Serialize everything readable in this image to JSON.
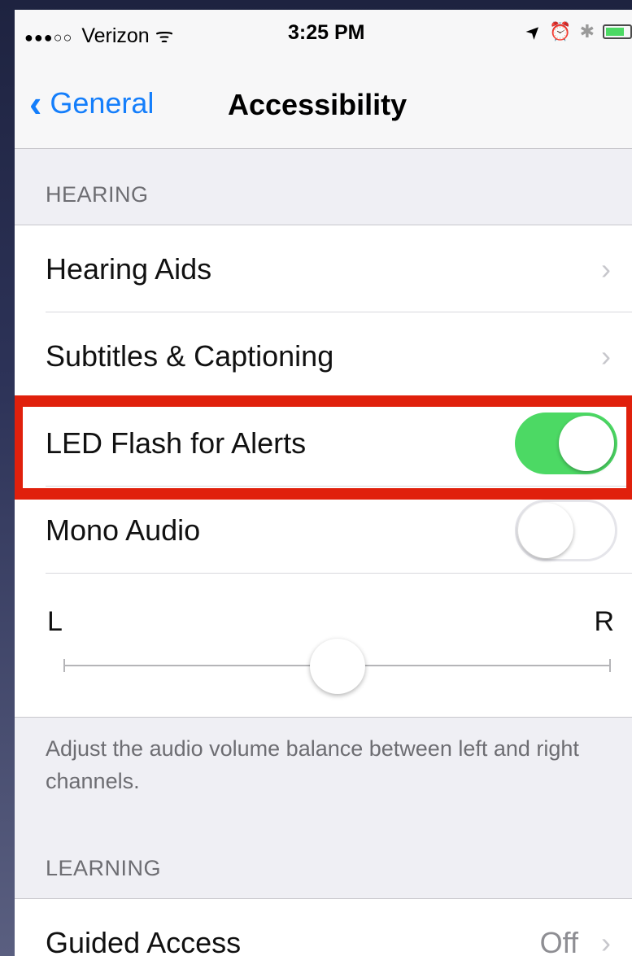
{
  "status_bar": {
    "signal_dots": "●●●○○",
    "carrier": "Verizon",
    "wifi_glyph": "ᯤ",
    "time": "3:25 PM",
    "location_glyph": "➤",
    "alarm_glyph": "⏰",
    "bluetooth_glyph": "✱"
  },
  "nav": {
    "back_label": "General",
    "title": "Accessibility"
  },
  "sections": {
    "hearing_header": "HEARING",
    "learning_header": "LEARNING"
  },
  "rows": {
    "hearing_aids": {
      "label": "Hearing Aids"
    },
    "subtitles": {
      "label": "Subtitles & Captioning"
    },
    "led_flash": {
      "label": "LED Flash for Alerts",
      "on": true
    },
    "mono_audio": {
      "label": "Mono Audio",
      "on": false
    },
    "guided_access": {
      "label": "Guided Access",
      "value": "Off"
    }
  },
  "balance": {
    "left_label": "L",
    "right_label": "R",
    "position": 0.5,
    "description": "Adjust the audio volume balance between left and right channels."
  },
  "colors": {
    "accent": "#147efb",
    "toggle_on": "#4cd964",
    "highlight": "#e0200c"
  },
  "icons": {
    "chevron": "›",
    "back_chevron": "‹"
  }
}
